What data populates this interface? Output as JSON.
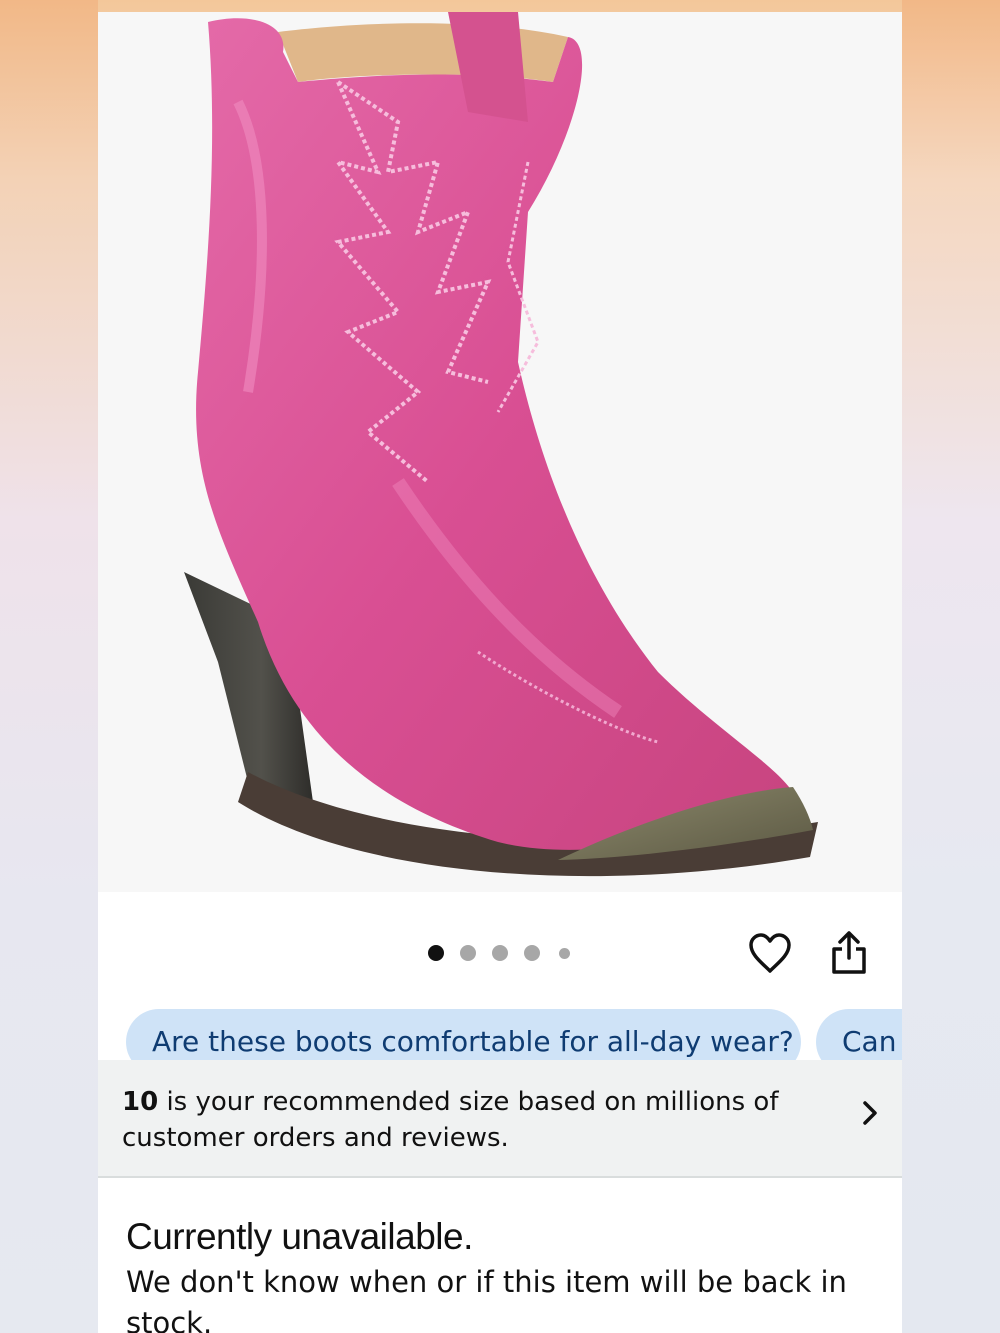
{
  "carousel": {
    "total_images": 5,
    "current_index": 1
  },
  "actions": {
    "favorite_icon": "heart-icon",
    "share_icon": "share-icon"
  },
  "question_chips": [
    {
      "label": "Are these boots comfortable for all-day wear?"
    },
    {
      "label": "Can"
    }
  ],
  "size_recommendation": {
    "size": "10",
    "text": " is your recommended size based on millions of customer orders and reviews.",
    "chevron_icon": "chevron-right-icon"
  },
  "availability": {
    "title": "Currently unavailable.",
    "description": "We don't know when or if this item will be back in stock."
  },
  "colors": {
    "chip_bg": "#cfe3f7",
    "chip_text": "#0f3c72",
    "boot_pink": "#e0579b"
  }
}
